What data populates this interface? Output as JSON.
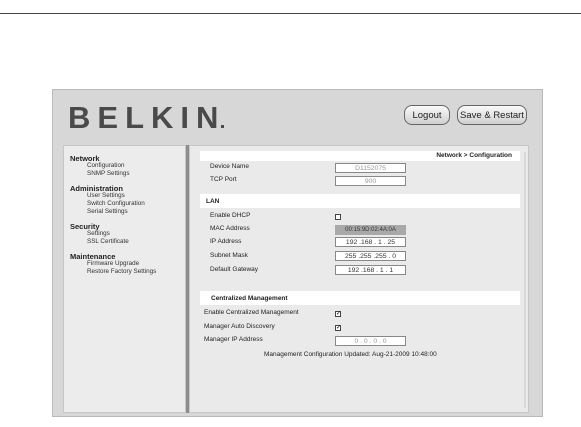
{
  "brand": {
    "logo": "BELKIN"
  },
  "header": {
    "logout_label": "Logout",
    "save_restart_label": "Save & Restart"
  },
  "sidebar": {
    "sections": [
      {
        "title": "Network",
        "items": [
          "Configuration",
          "SNMP Settings"
        ]
      },
      {
        "title": "Administration",
        "items": [
          "User Settings",
          "Switch Configuration",
          "Serial Settings"
        ]
      },
      {
        "title": "Security",
        "items": [
          "Settings",
          "SSL Certificate"
        ]
      },
      {
        "title": "Maintenance",
        "items": [
          "Firmware Upgrade",
          "Restore Factory Settings"
        ]
      }
    ]
  },
  "main": {
    "breadcrumb": "Network > Configuration",
    "device_name_label": "Device Name",
    "device_name_value": "D1152075",
    "tcp_port_label": "TCP Port",
    "tcp_port_value": "900",
    "lan_title": "LAN",
    "enable_dhcp_label": "Enable DHCP",
    "enable_dhcp_checked": false,
    "mac_label": "MAC Address",
    "mac_value": "00:15:9D:02:4A:0A",
    "ip_label": "IP Address",
    "ip_value": "192 .168 . 1 . 25",
    "subnet_label": "Subnet Mask",
    "subnet_value": "255 .255 .255 . 0",
    "gateway_label": "Default Gateway",
    "gateway_value": "192 .168 . 1 . 1",
    "cm_title": "Centralized Management",
    "enable_cm_label": "Enable Centralized Management",
    "enable_cm_checked": true,
    "auto_discovery_label": "Manager Auto Discovery",
    "auto_discovery_checked": true,
    "manager_ip_label": "Manager IP Address",
    "manager_ip_value": "0 . 0 . 0 . 0",
    "updated_text": "Management Configuration Updated: Aug-21-2009 10:48:00"
  },
  "colors": {
    "frame_bg": "#d7d7d7",
    "panel_bg": "#eaeaea",
    "divider": "#8d8d8d"
  }
}
